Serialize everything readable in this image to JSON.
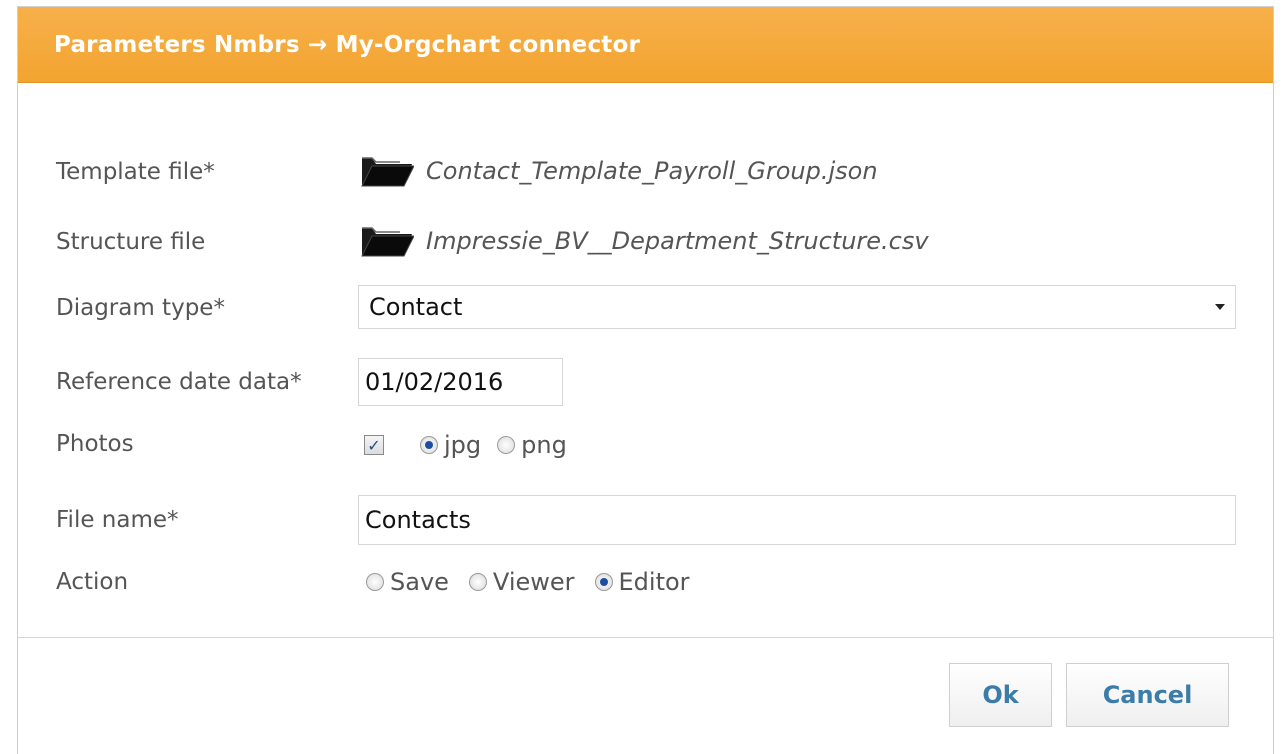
{
  "dialog": {
    "title": "Parameters Nmbrs → My-Orgchart connector"
  },
  "form": {
    "template_file": {
      "label": "Template file*",
      "value": "Contact_Template_Payroll_Group.json",
      "icon": "folder-icon"
    },
    "structure_file": {
      "label": "Structure file",
      "value": "Impressie_BV__Department_Structure.csv",
      "icon": "folder-icon"
    },
    "diagram_type": {
      "label": "Diagram type*",
      "value": "Contact"
    },
    "reference_date": {
      "label": "Reference date data*",
      "value": "01/02/2016"
    },
    "photos": {
      "label": "Photos",
      "checked": true,
      "formats": [
        {
          "label": "jpg",
          "selected": true
        },
        {
          "label": "png",
          "selected": false
        }
      ]
    },
    "file_name": {
      "label": "File name*",
      "value": "Contacts"
    },
    "action": {
      "label": "Action",
      "options": [
        {
          "label": "Save",
          "selected": false
        },
        {
          "label": "Viewer",
          "selected": false
        },
        {
          "label": "Editor",
          "selected": true
        }
      ]
    }
  },
  "buttons": {
    "ok": "Ok",
    "cancel": "Cancel"
  },
  "colors": {
    "title_bar": "#f3a430",
    "button_text": "#3b7ca8",
    "radio_selected": "#1d4fa0"
  }
}
